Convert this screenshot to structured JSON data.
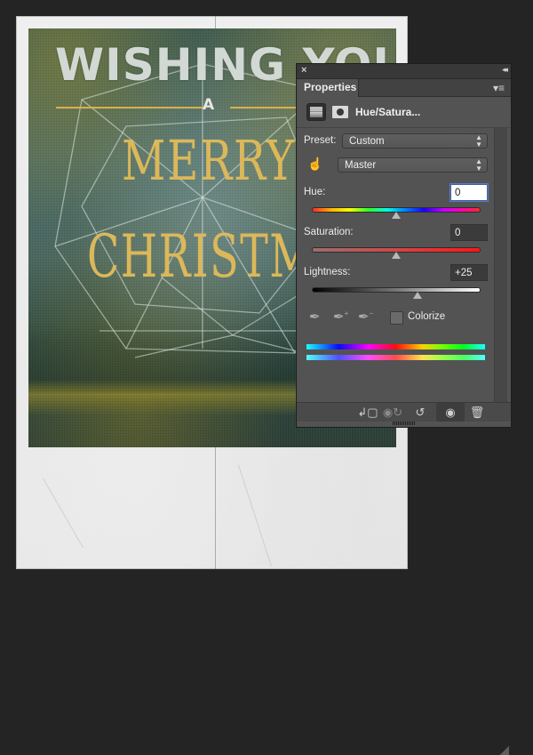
{
  "canvas": {
    "headline_top": "WISHING YOU",
    "headline_a": "A",
    "headline_merry": "MERRY",
    "headline_christmas": "CHRISTMAS",
    "colors": {
      "gold": "#dcb85a",
      "teal_dark": "#2c3f36",
      "paper": "#ececec"
    }
  },
  "panel": {
    "close_icon": "×",
    "collapse_icon": "◂◂",
    "tab_label": "Properties",
    "menu_icon": "▾≡",
    "adjustment_title": "Hue/Satura...",
    "preset_label": "Preset:",
    "preset_value": "Custom",
    "channel_value": "Master",
    "hue_label": "Hue:",
    "hue_value": "0",
    "hue_fraction": 0.5,
    "saturation_label": "Saturation:",
    "saturation_value": "0",
    "saturation_fraction": 0.5,
    "lightness_label": "Lightness:",
    "lightness_value": "+25",
    "lightness_fraction": 0.625,
    "colorize_label": "Colorize",
    "colorize_checked": false,
    "footer": {
      "clip_icon": "clip-to-layer",
      "view_previous_icon": "view-previous",
      "reset_icon": "reset",
      "visibility_icon": "eye",
      "delete_icon": "trash"
    }
  }
}
